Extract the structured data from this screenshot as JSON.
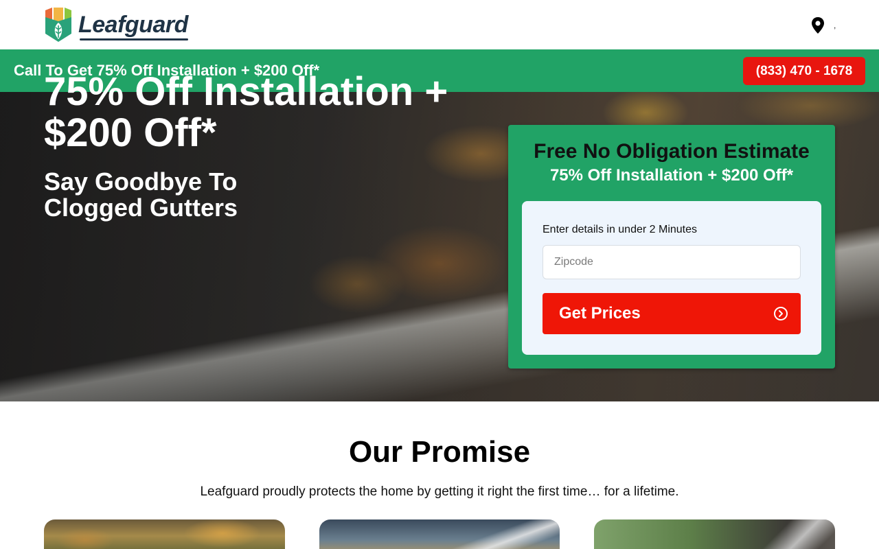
{
  "header": {
    "brand": "Leafguard",
    "location_text": ",",
    "icons": {
      "location": "map-pin-icon"
    }
  },
  "promo": {
    "text": "Call To Get 75% Off Installation + $200 Off*",
    "phone": "(833) 470 - 1678"
  },
  "hero": {
    "title": "75% Off Installation + $200 Off*",
    "subtitle": "Say Goodbye To Clogged Gutters"
  },
  "estimate": {
    "title": "Free No Obligation Estimate",
    "subtitle": "75% Off Installation + $200 Off*",
    "form_label": "Enter details in under 2 Minutes",
    "zip_placeholder": "Zipcode",
    "zip_value": "",
    "submit_label": "Get Prices",
    "submit_icon": "arrow-circle-right-icon"
  },
  "promise": {
    "title": "Our Promise",
    "text": "Leafguard proudly protects the home by getting it right the first time… for a lifetime."
  },
  "colors": {
    "brand_green": "#21a366",
    "cta_red": "#ef1607",
    "phone_red": "#e8160f",
    "form_bg": "#eef5fd",
    "logo_navy": "#1f3345"
  }
}
